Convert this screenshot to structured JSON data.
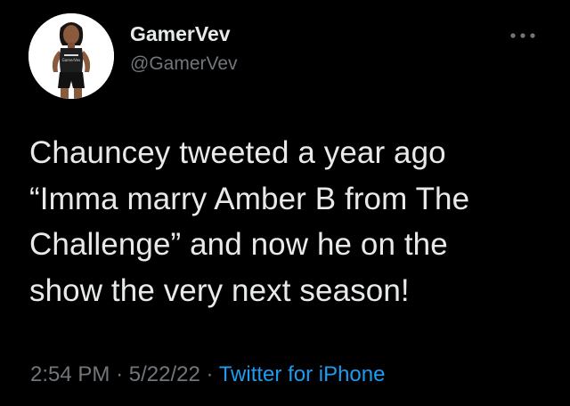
{
  "user": {
    "display_name": "GamerVev",
    "handle": "@GamerVev",
    "avatar_icon": "profile-photo",
    "avatar_shirt_text": "GamerVev"
  },
  "tweet": {
    "lines": [
      "Chauncey tweeted a year ago",
      "“Imma marry Amber B from The",
      "Challenge” and now he on the",
      "show the very next season!"
    ]
  },
  "meta": {
    "time": "2:54 PM",
    "separator": "·",
    "date": "5/22/22",
    "source": "Twitter for iPhone"
  },
  "colors": {
    "background": "#000000",
    "primary_text": "#e7e9ea",
    "secondary_text": "#71767b",
    "accent": "#1d9bf0"
  },
  "icons": {
    "more": "more-horizontal-icon"
  }
}
